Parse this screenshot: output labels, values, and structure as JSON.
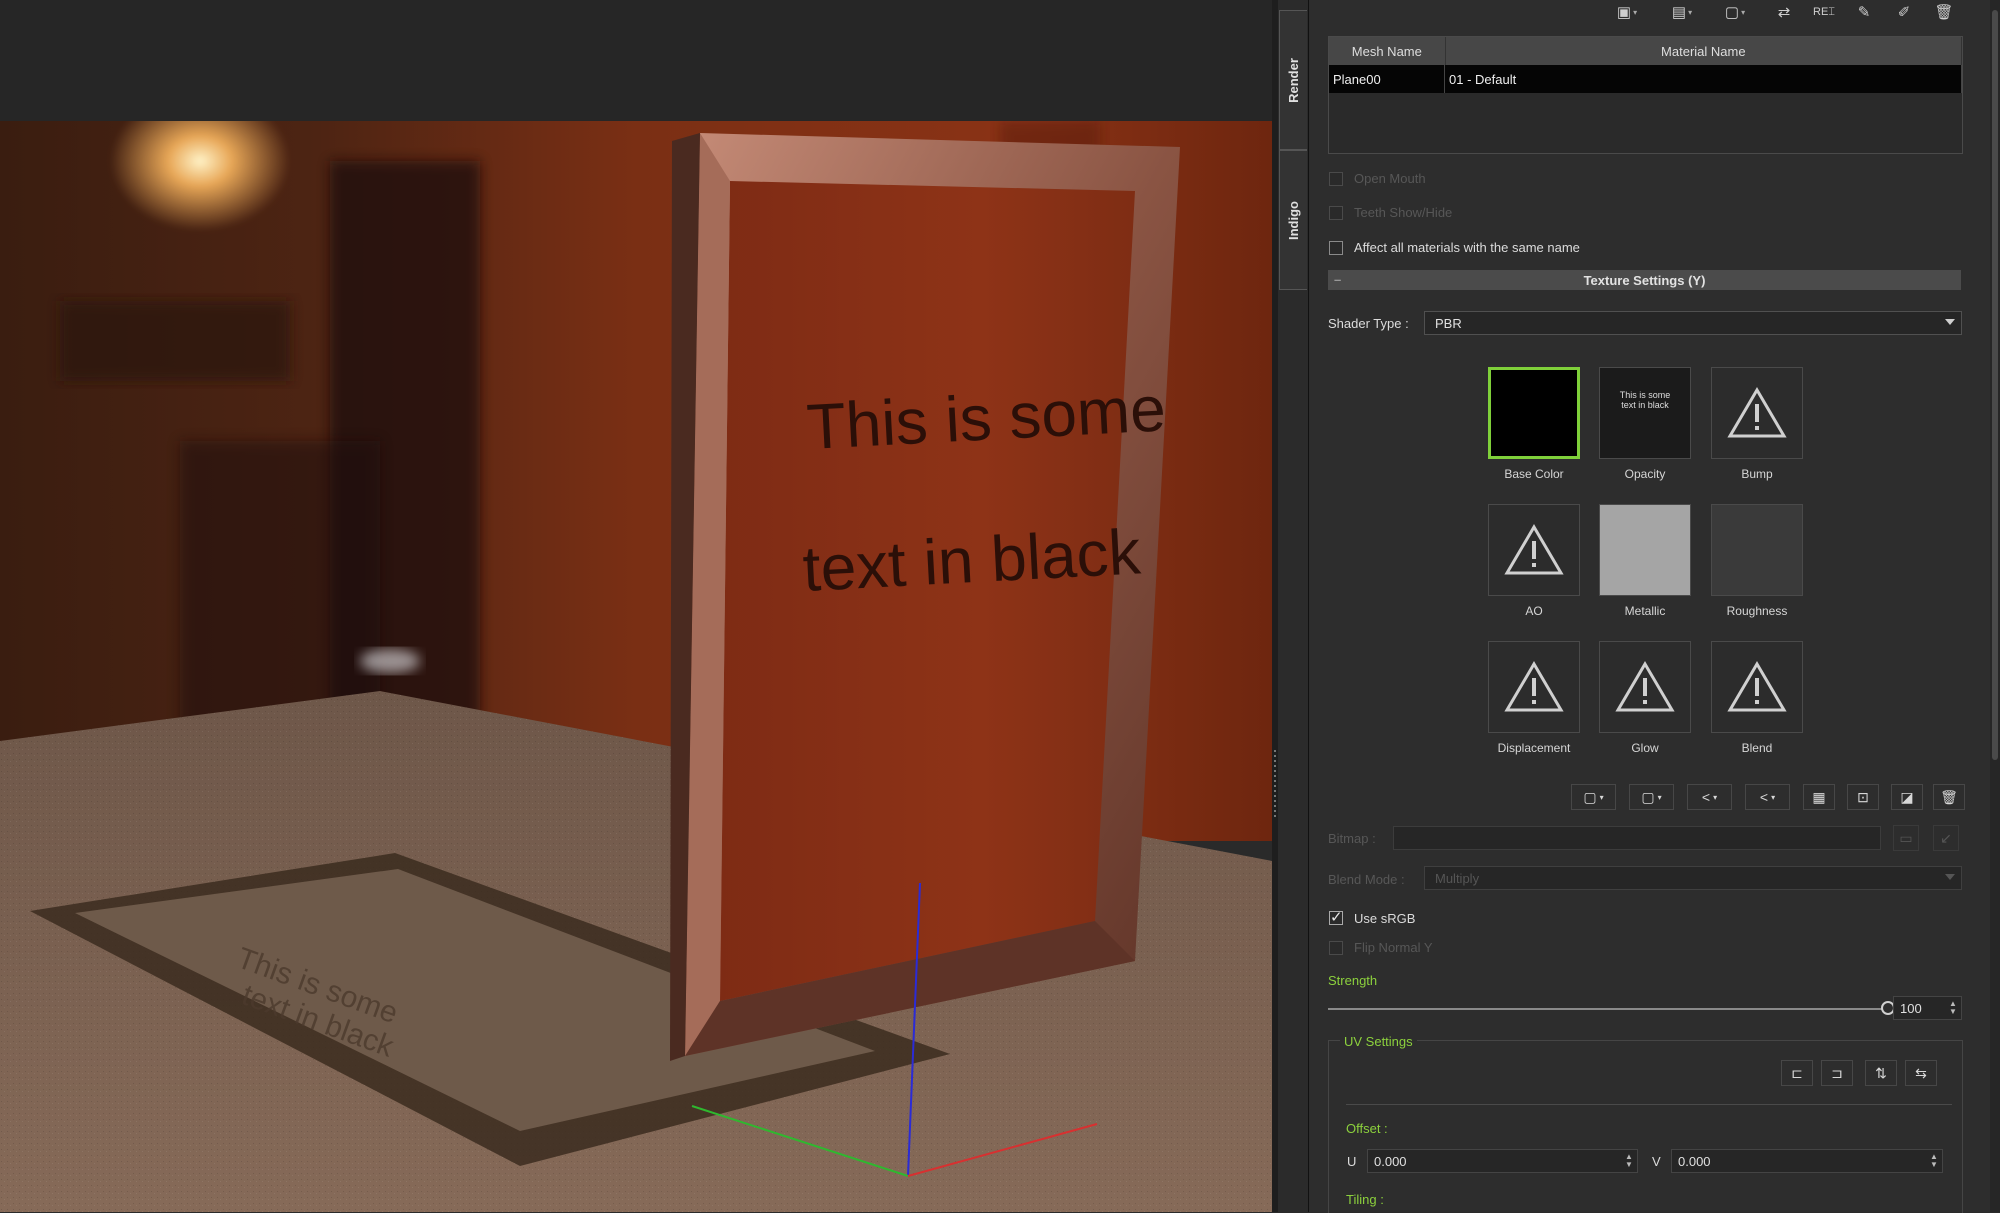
{
  "side_tabs": [
    "Render",
    "Indigo"
  ],
  "scene": {
    "sign_text_line1": "This is some",
    "sign_text_line2": "text in black"
  },
  "mesh_table": {
    "columns": [
      "Mesh Name",
      "Material Name"
    ],
    "rows": [
      {
        "mesh": "Plane00",
        "material": "01 - Default"
      }
    ]
  },
  "options": {
    "open_mouth": "Open Mouth",
    "teeth_show_hide": "Teeth Show/Hide",
    "affect_all": "Affect all materials with the same name"
  },
  "texture_settings": {
    "title": "Texture Settings  (Y)",
    "shader_type_label": "Shader Type :",
    "shader_type_value": "PBR",
    "slots": [
      "Base Color",
      "Opacity",
      "Bump",
      "AO",
      "Metallic",
      "Roughness",
      "Displacement",
      "Glow",
      "Blend"
    ],
    "opacity_thumb_line1": "This is some",
    "opacity_thumb_line2": "text in black",
    "bitmap_label": "Bitmap :",
    "bitmap_value": "",
    "blend_mode_label": "Blend Mode :",
    "blend_mode_value": "Multiply",
    "use_srgb_label": "Use sRGB",
    "use_srgb_checked": true,
    "flip_normal_label": "Flip Normal Y",
    "strength_label": "Strength",
    "strength_value": "100",
    "strength_fraction": 1.0
  },
  "uv_settings": {
    "title": "UV Settings",
    "offset_label": "Offset :",
    "u_label": "U",
    "u_value": "0.000",
    "v_label": "V",
    "v_value": "0.000",
    "tiling_label": "Tiling :"
  },
  "colors": {
    "accent_green": "#8cd13d",
    "base_color_slot_border": "#7fd03a",
    "panel_bg": "#2d2d2d"
  }
}
